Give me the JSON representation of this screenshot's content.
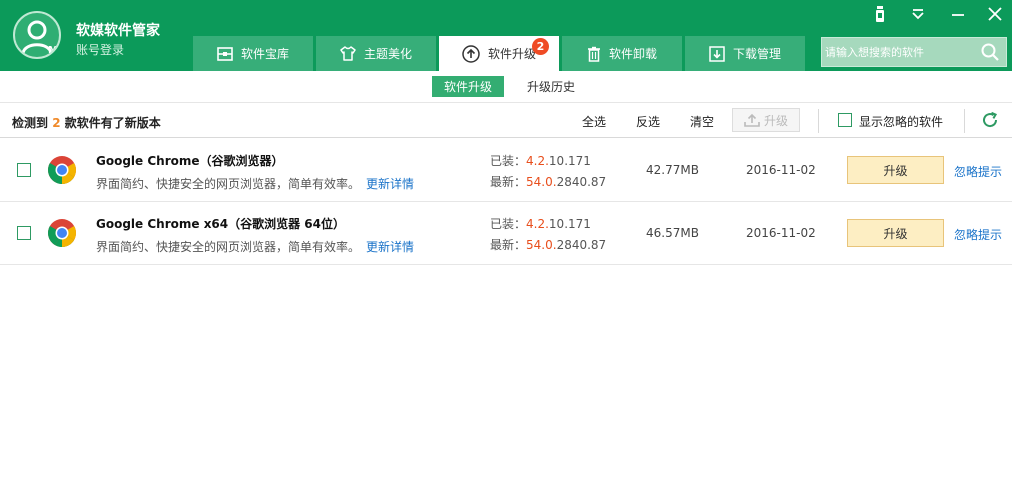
{
  "header": {
    "app_title": "软媒软件管家",
    "account": "账号登录",
    "tabs": [
      {
        "label": "软件宝库"
      },
      {
        "label": "主题美化"
      },
      {
        "label": "软件升级",
        "badge": "2"
      },
      {
        "label": "软件卸载"
      },
      {
        "label": "下载管理"
      }
    ],
    "search_placeholder": "请输入想搜索的软件",
    "accent": "#0c9a5a"
  },
  "subtabs": [
    "软件升级",
    "升级历史"
  ],
  "toolbar": {
    "detect_prefix": "检测到",
    "detect_count": "2",
    "detect_suffix": "款软件有了新版本",
    "select_all": "全选",
    "invert": "反选",
    "clear": "清空",
    "upgrade": "升级",
    "show_ignored": "显示忽略的软件"
  },
  "rows": [
    {
      "name": "Google Chrome（谷歌浏览器）",
      "desc": "界面简约、快捷安全的网页浏览器，简单有效率。",
      "details": "更新详情",
      "installed_label": "已装：",
      "installed_hl": "4.2.",
      "installed_rest": "10.171",
      "latest_label": "最新：",
      "latest_hl": "54.0.",
      "latest_rest": "2840.87",
      "size": "42.77MB",
      "date": "2016-11-02",
      "button": "升级",
      "ignore": "忽略提示"
    },
    {
      "name": "Google Chrome x64（谷歌浏览器 64位）",
      "desc": "界面简约、快捷安全的网页浏览器，简单有效率。",
      "details": "更新详情",
      "installed_label": "已装：",
      "installed_hl": "4.2.",
      "installed_rest": "10.171",
      "latest_label": "最新：",
      "latest_hl": "54.0.",
      "latest_rest": "2840.87",
      "size": "46.57MB",
      "date": "2016-11-02",
      "button": "升级",
      "ignore": "忽略提示"
    }
  ]
}
